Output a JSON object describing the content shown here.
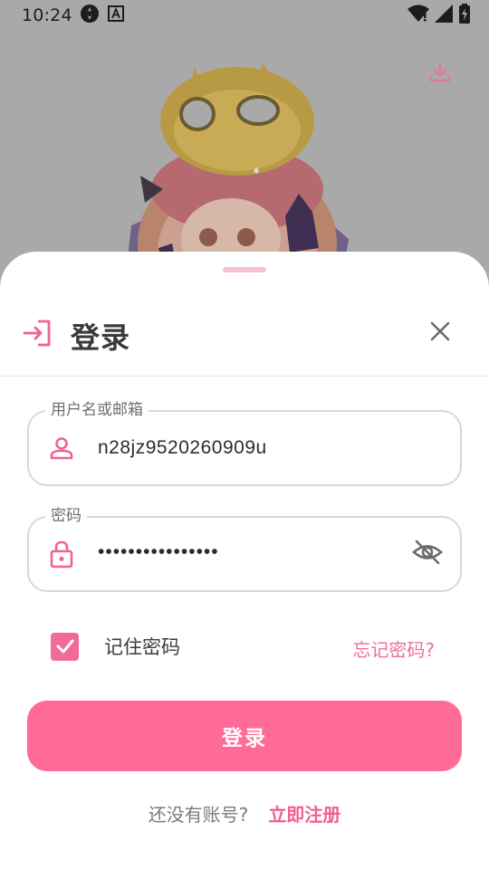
{
  "status_bar": {
    "time": "10:24",
    "icons": [
      "settings-icon",
      "font-icon",
      "wifi-icon",
      "signal-icon",
      "battery-icon"
    ]
  },
  "background": {
    "description_icon": "anime-character-illustration",
    "download_icon": "download-icon"
  },
  "login_sheet": {
    "title": "登录",
    "title_icon": "login-icon",
    "close_icon": "close-icon",
    "username": {
      "label": "用户名或邮箱",
      "value": "n28jz9520260909u",
      "icon": "person-icon"
    },
    "password": {
      "label": "密码",
      "value": "••••••••••••••••",
      "icon": "lock-icon",
      "toggle_icon": "eye-off-icon"
    },
    "remember_me": {
      "label": "记住密码",
      "checked": true
    },
    "forgot_password": "忘记密码?",
    "login_button": "登录",
    "register_prompt": "还没有账号?",
    "register_link": "立即注册"
  },
  "colors": {
    "accent": "#ff6b99",
    "accent_text": "#ef5e8e",
    "overlay": "#a9a9a9"
  }
}
